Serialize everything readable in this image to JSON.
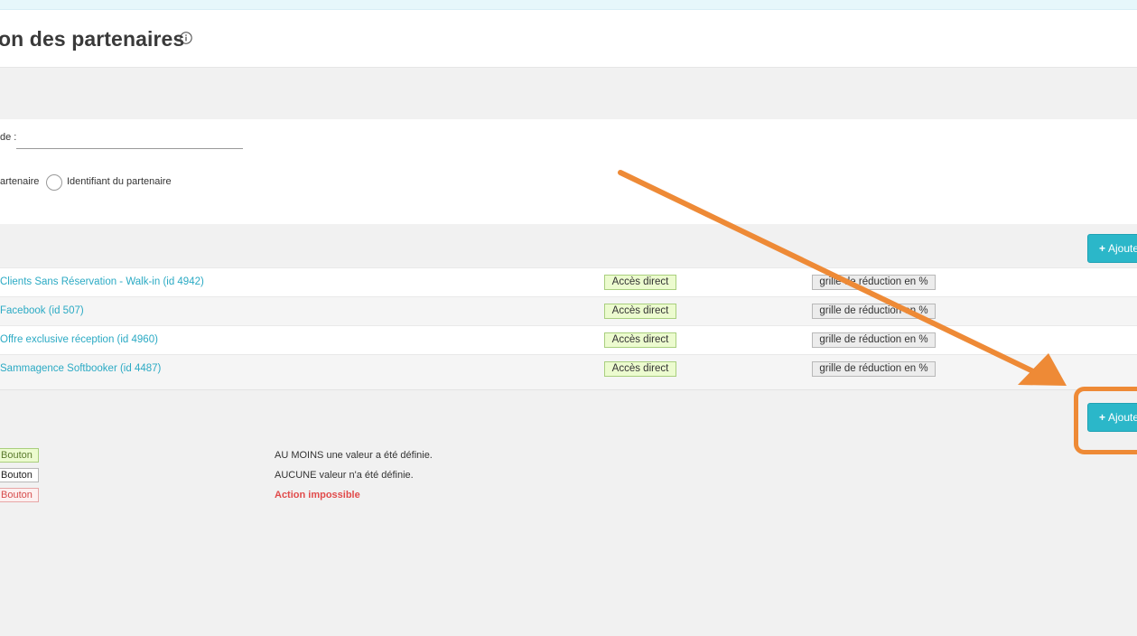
{
  "header": {
    "title": "on des partenaires",
    "info_icon": "info-circle-icon"
  },
  "filters": {
    "search_label": "de :",
    "search_value": "",
    "radio_option_name": "artenaire",
    "radio_option_id": "Identifiant du partenaire"
  },
  "actions": {
    "add_button_label": "Ajoute",
    "add_icon": "plus-icon"
  },
  "partners": [
    {
      "name": "Clients Sans Réservation - Walk-in (id 4942)",
      "access": "Accès direct",
      "grid": "grille de réduction en %"
    },
    {
      "name": "Facebook (id 507)",
      "access": "Accès direct",
      "grid": "grille de réduction en %"
    },
    {
      "name": "Offre exclusive réception (id 4960)",
      "access": "Accès direct",
      "grid": "grille de réduction en %"
    },
    {
      "name": "Sammagence Softbooker (id 4487)",
      "access": "Accès direct",
      "grid": "grille de réduction en %"
    }
  ],
  "legend": [
    {
      "badge": "Bouton",
      "description": "AU MOINS une valeur a été définie.",
      "state": "set",
      "color": "#ecfbcf"
    },
    {
      "badge": "Bouton",
      "description": "AUCUNE valeur n'a été définie.",
      "state": "unset",
      "color": "#ffffff"
    },
    {
      "badge": "Bouton",
      "description": "Action impossible",
      "state": "impossible",
      "color": "#e14b4b"
    }
  ],
  "colors": {
    "accent": "#2bb7c9",
    "link": "#2baac4",
    "annotation": "#ee8a36"
  }
}
